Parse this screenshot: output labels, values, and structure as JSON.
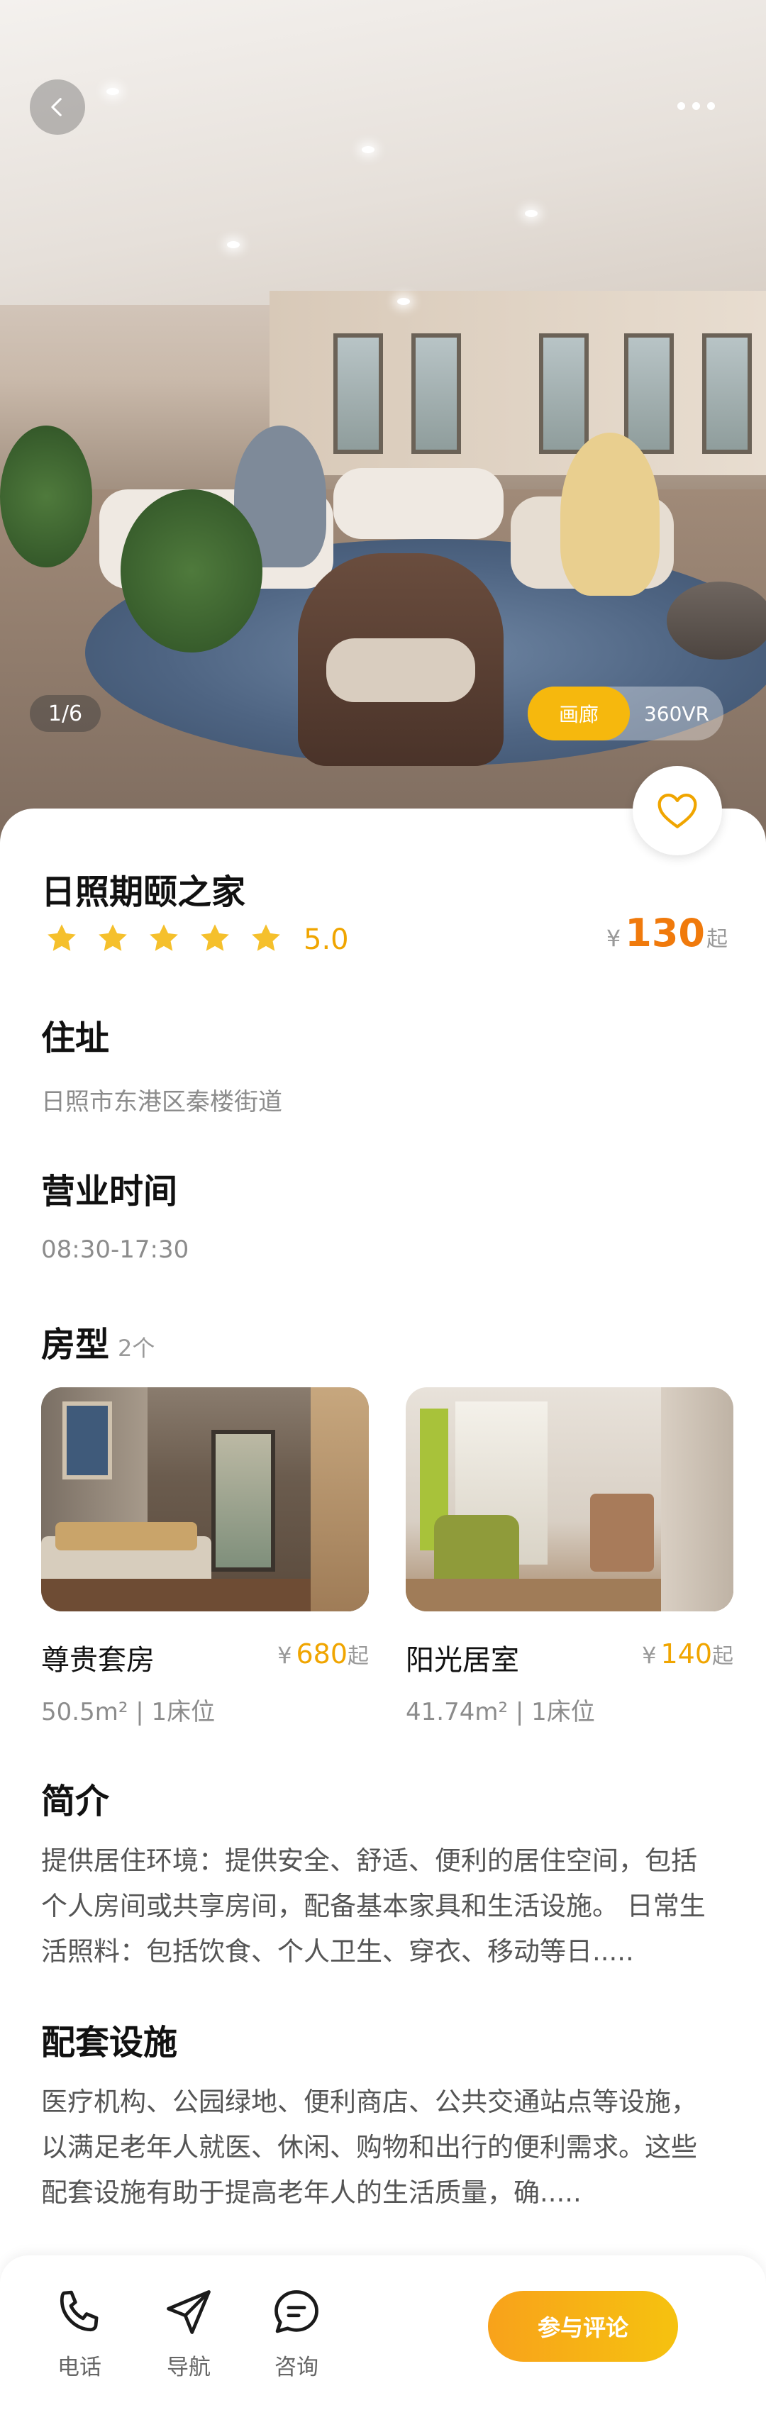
{
  "hero": {
    "counter": "1/6",
    "media_tabs": [
      "画廊",
      "360VR"
    ]
  },
  "listing": {
    "title": "日照期颐之家",
    "rating": "5.0",
    "stars": 5,
    "price": {
      "currency": "¥",
      "value": "130",
      "suffix": "起"
    }
  },
  "address": {
    "label": "住址",
    "value": "日照市东港区秦楼街道"
  },
  "hours": {
    "label": "营业时间",
    "value": "08:30-17:30"
  },
  "rooms": {
    "label": "房型",
    "count": "2个",
    "items": [
      {
        "name": "尊贵套房",
        "currency": "¥",
        "price": "680",
        "suffix": "起",
        "spec": "50.5m² | 1床位"
      },
      {
        "name": "阳光居室",
        "currency": "¥",
        "price": "140",
        "suffix": "起",
        "spec": "41.74m² | 1床位"
      }
    ]
  },
  "intro": {
    "label": "简介",
    "text": "提供居住环境：提供安全、舒适、便利的居住空间，包括个人房间或共享房间，配备基本家具和生活设施。 日常生活照料：包括饮食、个人卫生、穿衣、移动等日....."
  },
  "facilities": {
    "label": "配套设施",
    "text": "医疗机构、公园绿地、便利商店、公共交通站点等设施，以满足老年人就医、休闲、购物和出行的便利需求。这些配套设施有助于提高老年人的生活质量，确....."
  },
  "bottom_bar": {
    "tabs": [
      {
        "label": "电话",
        "icon": "phone-icon"
      },
      {
        "label": "导航",
        "icon": "send-icon"
      },
      {
        "label": "咨询",
        "icon": "chat-icon"
      }
    ],
    "cta": "参与评论"
  },
  "colors": {
    "accent": "#f6b80d",
    "price": "#f07a0c",
    "rating": "#f0a500"
  }
}
